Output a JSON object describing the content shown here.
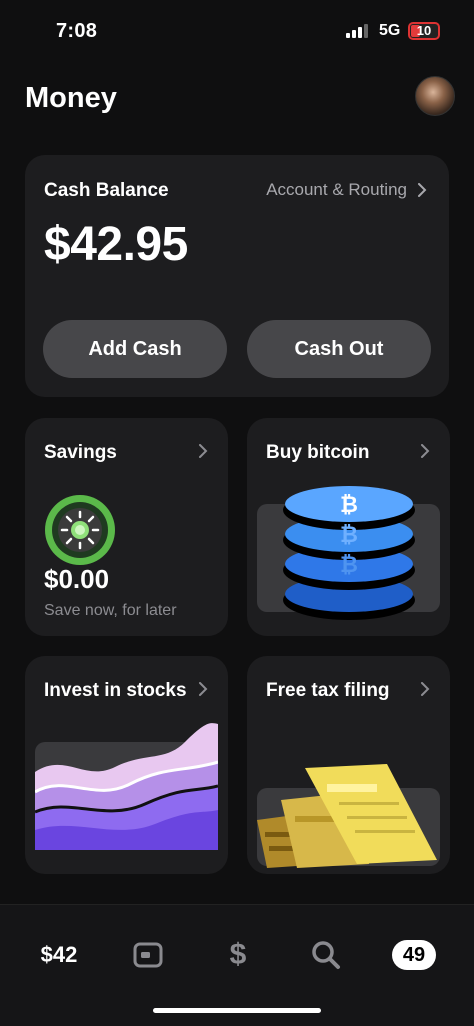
{
  "status_bar": {
    "time": "7:08",
    "network": "5G",
    "battery": "10"
  },
  "header": {
    "title": "Money"
  },
  "cash_card": {
    "label": "Cash Balance",
    "routing_link": "Account & Routing",
    "balance": "$42.95",
    "add_cash": "Add Cash",
    "cash_out": "Cash Out"
  },
  "tiles": {
    "savings": {
      "title": "Savings",
      "amount": "$0.00",
      "subtitle": "Save now, for later"
    },
    "bitcoin": {
      "title": "Buy bitcoin"
    },
    "stocks": {
      "title": "Invest in stocks"
    },
    "tax": {
      "title": "Free tax filing"
    }
  },
  "tab_bar": {
    "balance": "$42",
    "dollar": "$",
    "activity_badge": "49"
  },
  "icons": [
    "chevron-right-icon",
    "savings-icon",
    "bitcoin-stack-icon",
    "stocks-waves-icon",
    "tax-documents-icon",
    "card-icon",
    "search-icon"
  ],
  "colors": {
    "background": "#0f0f10",
    "card": "#1d1d1f",
    "button": "#47474a",
    "accent_green": "#5bb94a",
    "bitcoin_blue": "#3b8ef0",
    "stocks_purple": "#8e6bf0",
    "tax_yellow": "#e8d24a"
  }
}
